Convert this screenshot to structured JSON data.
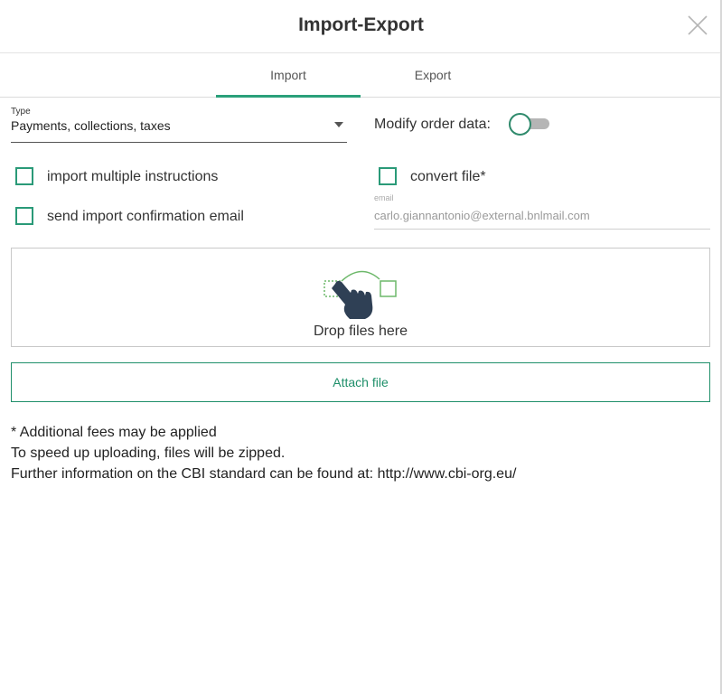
{
  "dialog": {
    "title": "Import-Export",
    "close_icon": "close-icon"
  },
  "tabs": [
    {
      "label": "Import",
      "active": true
    },
    {
      "label": "Export",
      "active": false
    }
  ],
  "form": {
    "type": {
      "label": "Type",
      "value": "Payments, collections, taxes",
      "icon": "chevron-down-icon"
    },
    "modify_order": {
      "label": "Modify order data:",
      "on": false
    },
    "checkboxes": {
      "import_multiple": {
        "label": "import multiple instructions",
        "checked": false
      },
      "convert_file": {
        "label": "convert file*",
        "checked": false
      },
      "send_confirmation": {
        "label": "send import confirmation email",
        "checked": false
      }
    },
    "email": {
      "label": "email",
      "value": "carlo.giannantonio@external.bnlmail.com"
    }
  },
  "dropzone": {
    "text": "Drop files here",
    "icon": "drag-hand-icon"
  },
  "attach_button": {
    "label": "Attach file"
  },
  "notes": [
    "* Additional fees may be applied",
    "To speed up uploading, files will be zipped.",
    "Further information on the CBI standard can be found at: http://www.cbi-org.eu/"
  ],
  "colors": {
    "accent": "#2aa07a",
    "border": "#c9c9c9",
    "text": "#333333",
    "hand": "#2f4055"
  }
}
